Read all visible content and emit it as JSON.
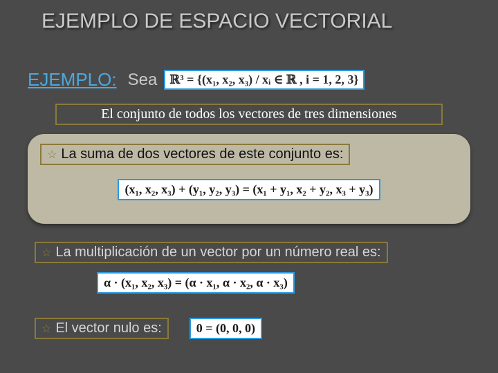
{
  "title": "EJEMPLO DE ESPACIO VECTORIAL",
  "ejemplo_label": "EJEMPLO:",
  "sea": "Sea",
  "r3_formula": "ℝ³ = {(x₁, x₂, x₃) / xᵢ ∈ ℝ , i = 1, 2, 3}",
  "subdesc": "El conjunto de todos los vectores de  tres dimensiones",
  "bullet1": "La suma de dos vectores de este conjunto es:",
  "sum_formula": "(x₁, x₂, x₃) + (y₁, y₂, y₃) = (x₁ + y₁, x₂ + y₂, x₃ + y₃)",
  "bullet2": "La multiplicación de un vector por un número real es:",
  "scalar_formula": "α · (x₁, x₂, x₃) = (α · x₁, α · x₂, α · x₃)",
  "bullet3": "El vector nulo es:",
  "zero_formula": "0 = (0, 0, 0)",
  "star": "☆"
}
